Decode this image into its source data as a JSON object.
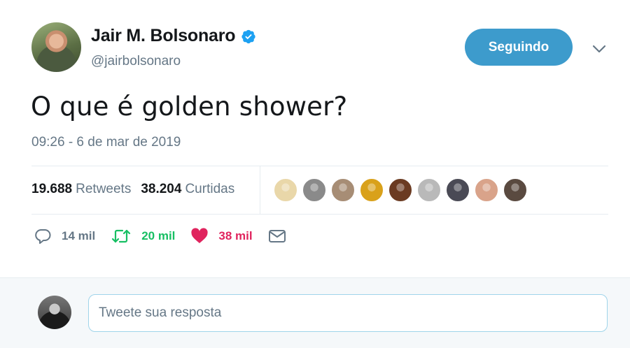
{
  "author": {
    "name": "Jair M. Bolsonaro",
    "handle": "@jairbolsonaro",
    "verified": true,
    "avatar_icon": "profile-photo"
  },
  "follow_button": {
    "label": "Seguindo",
    "color": "#3d9bcc"
  },
  "tweet": {
    "text": "O que é golden shower?",
    "timestamp": "09:26 - 6 de mar de 2019"
  },
  "stats": {
    "retweets_count": "19.688",
    "retweets_label": "Retweets",
    "likes_count": "38.204",
    "likes_label": "Curtidas"
  },
  "likers": [
    {
      "color": "#e9d7a9"
    },
    {
      "color": "#8a8a8a"
    },
    {
      "color": "#a78d75"
    },
    {
      "color": "#d9a11b"
    },
    {
      "color": "#6b3b22"
    },
    {
      "color": "#b9b9b9"
    },
    {
      "color": "#4a4a55"
    },
    {
      "color": "#d9a38a"
    },
    {
      "color": "#5a4a40"
    }
  ],
  "actions": {
    "reply_count": "14 mil",
    "retweet_count": "20 mil",
    "like_count": "38 mil",
    "retweet_color": "#17bf63",
    "like_color": "#e0245e"
  },
  "reply_box": {
    "placeholder": "Tweete sua resposta"
  }
}
